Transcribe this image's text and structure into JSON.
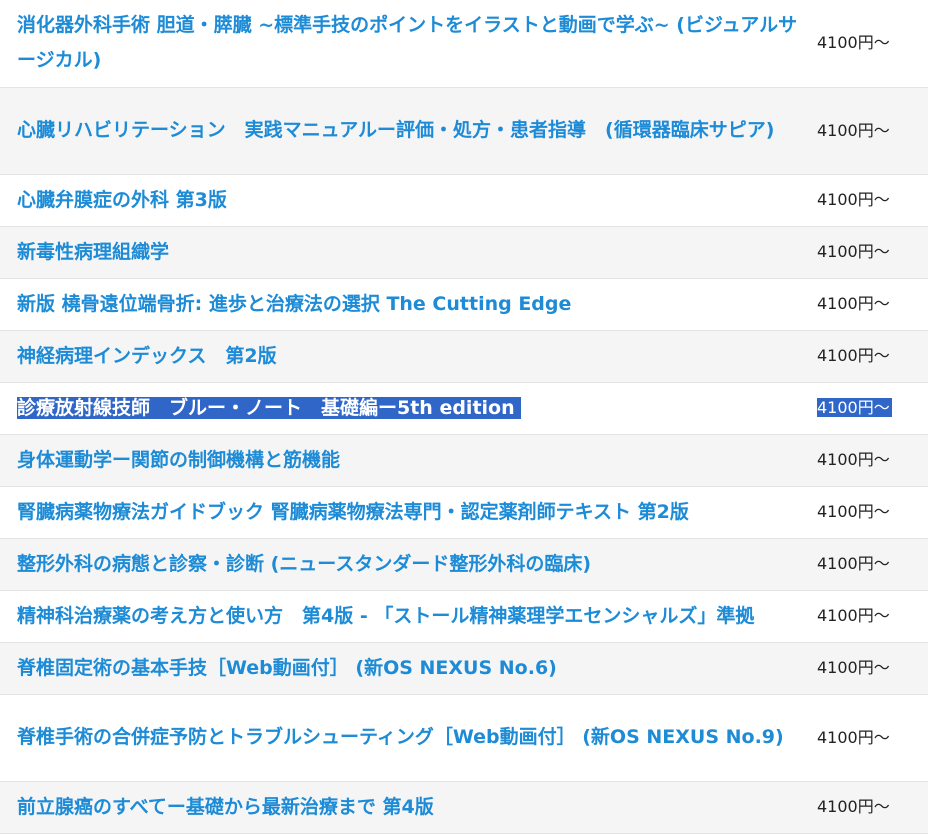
{
  "books": [
    {
      "title": "消化器外科手術 胆道・膵臓 ~標準手技のポイントをイラストと動画で学ぶ~ (ビジュアルサージカル)",
      "price": "4100円～"
    },
    {
      "title": "心臓リハビリテーション　実践マニュアルー評価・処方・患者指導　(循環器臨床サピア)",
      "price": "4100円～"
    },
    {
      "title": "心臓弁膜症の外科 第3版",
      "price": "4100円～"
    },
    {
      "title": "新毒性病理組織学",
      "price": "4100円～"
    },
    {
      "title": "新版 橈骨遠位端骨折: 進歩と治療法の選択 The Cutting Edge",
      "price": "4100円～"
    },
    {
      "title": "神経病理インデックス　第2版",
      "price": "4100円～"
    },
    {
      "title": "診療放射線技師　ブルー・ノート　基礎編ー5th edition",
      "price": "4100円～"
    },
    {
      "title": "身体運動学ー関節の制御機構と筋機能",
      "price": "4100円～"
    },
    {
      "title": "腎臓病薬物療法ガイドブック 腎臓病薬物療法専門・認定薬剤師テキスト 第2版",
      "price": "4100円～"
    },
    {
      "title": "整形外科の病態と診察・診断 (ニュースタンダード整形外科の臨床)",
      "price": "4100円～"
    },
    {
      "title": "精神科治療薬の考え方と使い方　第4版 - 「ストール精神薬理学エセンシャルズ」準拠",
      "price": "4100円～"
    },
    {
      "title": "脊椎固定術の基本手技［Web動画付］ (新OS NEXUS No.6)",
      "price": "4100円～"
    },
    {
      "title": "脊椎手術の合併症予防とトラブルシューティング［Web動画付］ (新OS NEXUS No.9)",
      "price": "4100円～"
    },
    {
      "title": "前立腺癌のすべてー基礎から最新治療まで 第4版",
      "price": "4100円～"
    }
  ]
}
